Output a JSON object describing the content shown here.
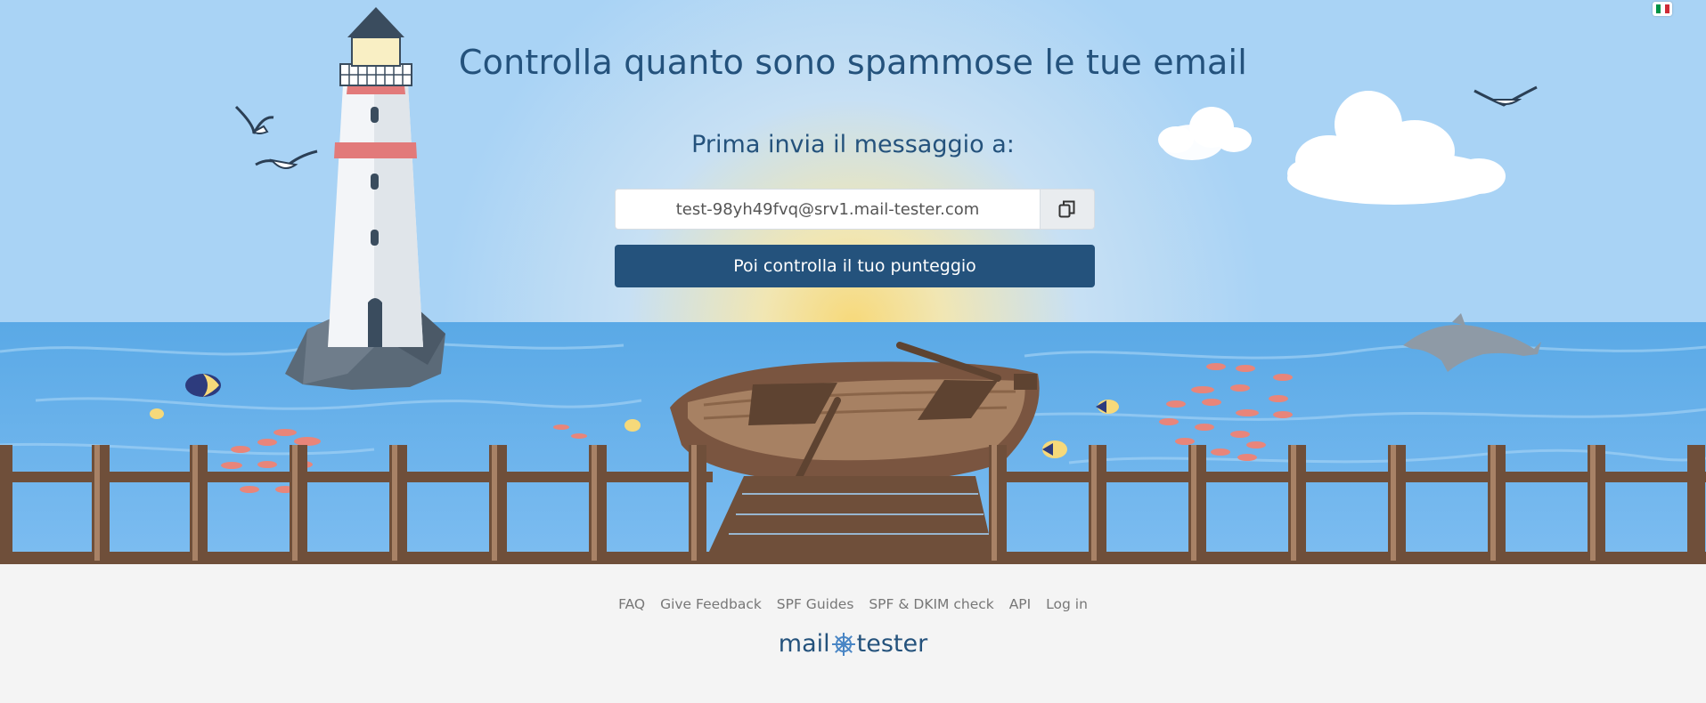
{
  "hero": {
    "title": "Controlla quanto sono spammose le tue email",
    "subtitle": "Prima invia il messaggio a:",
    "email_value": "test-98yh49fvq@srv1.mail-tester.com",
    "check_button_label": "Poi controlla il tuo punteggio"
  },
  "language": {
    "flag": "it-flag-icon",
    "colors": [
      "#009246",
      "#ffffff",
      "#ce2b37"
    ]
  },
  "footer": {
    "links": [
      "FAQ",
      "Give Feedback",
      "SPF Guides",
      "SPF & DKIM check",
      "API",
      "Log in"
    ],
    "logo_left": "mail",
    "logo_right": "tester"
  },
  "colors": {
    "brand": "#24527c",
    "sky": "#a9d4f5",
    "sea": "#68b3ed",
    "wood": "#6f4f3a",
    "footer_bg": "#f4f4f4"
  }
}
